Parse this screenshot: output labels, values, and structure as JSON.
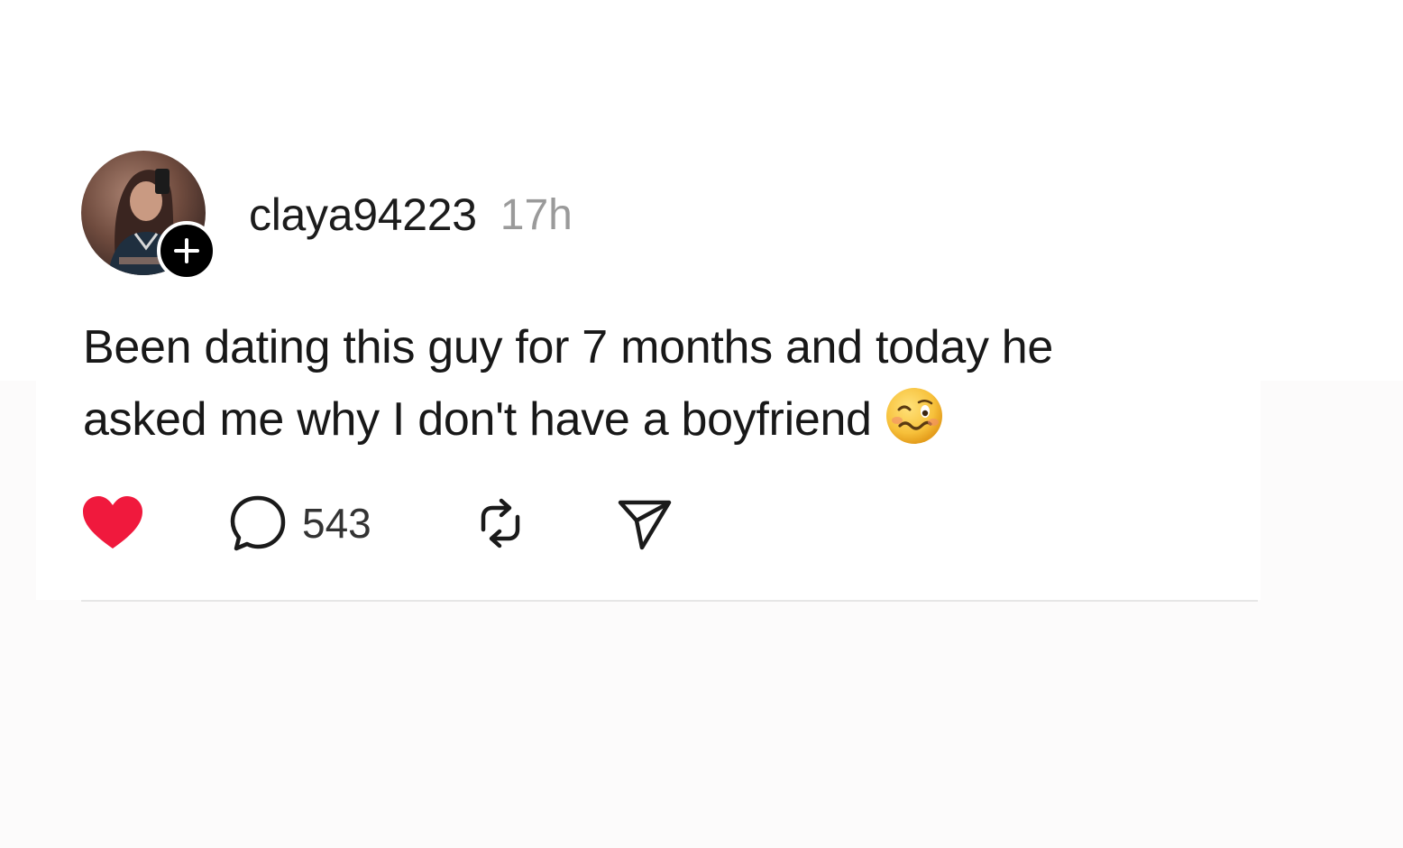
{
  "post": {
    "author": {
      "username": "claya94223",
      "avatar_icon": "profile-photo",
      "follow_icon": "plus-icon"
    },
    "timestamp": "17h",
    "text_line1": "Been dating this guy for 7 months and today he",
    "text_line2": "asked me why I don't have a boyfriend",
    "emoji": "woozy-face-emoji",
    "actions": {
      "like": {
        "icon": "heart-icon",
        "liked": true,
        "color": "#f0193d"
      },
      "reply": {
        "icon": "comment-icon",
        "count": "543"
      },
      "repost": {
        "icon": "repost-icon"
      },
      "share": {
        "icon": "send-icon"
      }
    }
  },
  "colors": {
    "background": "#ffffff",
    "text": "#1a1a1a",
    "muted": "#9a9a9a",
    "accent_like": "#f0193d",
    "divider": "#e6e6e6"
  }
}
